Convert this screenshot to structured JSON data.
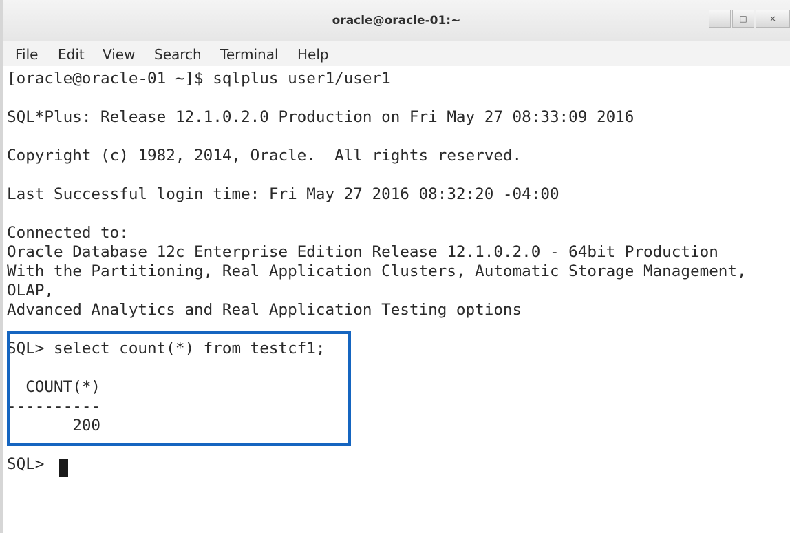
{
  "window": {
    "title": "oracle@oracle-01:~",
    "controls": {
      "minimize": "_",
      "maximize": "□",
      "close": "×"
    }
  },
  "menu": {
    "items": [
      "File",
      "Edit",
      "View",
      "Search",
      "Terminal",
      "Help"
    ]
  },
  "terminal": {
    "lines": [
      "[oracle@oracle-01 ~]$ sqlplus user1/user1",
      "",
      "SQL*Plus: Release 12.1.0.2.0 Production on Fri May 27 08:33:09 2016",
      "",
      "Copyright (c) 1982, 2014, Oracle.  All rights reserved.",
      "",
      "Last Successful login time: Fri May 27 2016 08:32:20 -04:00",
      "",
      "Connected to:",
      "Oracle Database 12c Enterprise Edition Release 12.1.0.2.0 - 64bit Production",
      "With the Partitioning, Real Application Clusters, Automatic Storage Management,",
      "OLAP,",
      "Advanced Analytics and Real Application Testing options",
      "",
      "SQL> select count(*) from testcf1;",
      "",
      "  COUNT(*)",
      "----------",
      "       200",
      "",
      "SQL> "
    ]
  },
  "colors": {
    "highlight_border": "#1565c0",
    "terminal_text": "#2a2a2a",
    "background": "#ffffff"
  }
}
